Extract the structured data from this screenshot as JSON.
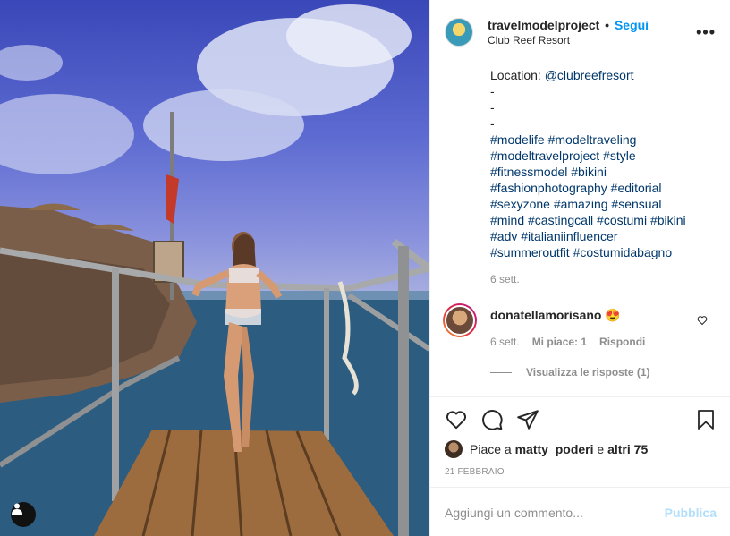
{
  "post": {
    "username": "travelmodelproject",
    "separator": "•",
    "follow_label": "Segui",
    "location": "Club Reef Resort",
    "more_label": "•••"
  },
  "caption": {
    "location_label": "Location: ",
    "location_handle": "@clubreefresort",
    "dashes": [
      "-",
      "-",
      "-"
    ],
    "hashtag_lines": [
      "#modelife #modeltraveling",
      "#modeltravelproject #style",
      "#fitnessmodel #bikini",
      "#fashionphotography #editorial",
      "#sexyzone #amazing #sensual",
      "#mind #castingcall #costumi #bikini",
      "#adv #italianiinfluencer",
      "#summeroutfit #costumidabagno"
    ],
    "time": "6 sett."
  },
  "reply": {
    "username": "donatellamorisano",
    "text": "😍",
    "time": "6 sett.",
    "likes": "Mi piace: 1",
    "reply_label": "Rispondi",
    "view_replies": "Visualizza le risposte (1)"
  },
  "likes": {
    "prefix": "Piace a ",
    "user": "matty_poderi",
    "middle": " e ",
    "others": "altri 75"
  },
  "date": "21 FEBBRAIO",
  "comment_box": {
    "placeholder": "Aggiungi un commento...",
    "publish_label": "Pubblica"
  },
  "icons": {
    "like": "heart-icon",
    "comment": "comment-icon",
    "share": "paper-plane-icon",
    "save": "bookmark-icon",
    "tag": "user-tag-icon"
  },
  "colors": {
    "accent": "#0095f6",
    "publish_disabled": "#b2dffc",
    "muted": "#8e8e8e",
    "link": "#00376b"
  }
}
